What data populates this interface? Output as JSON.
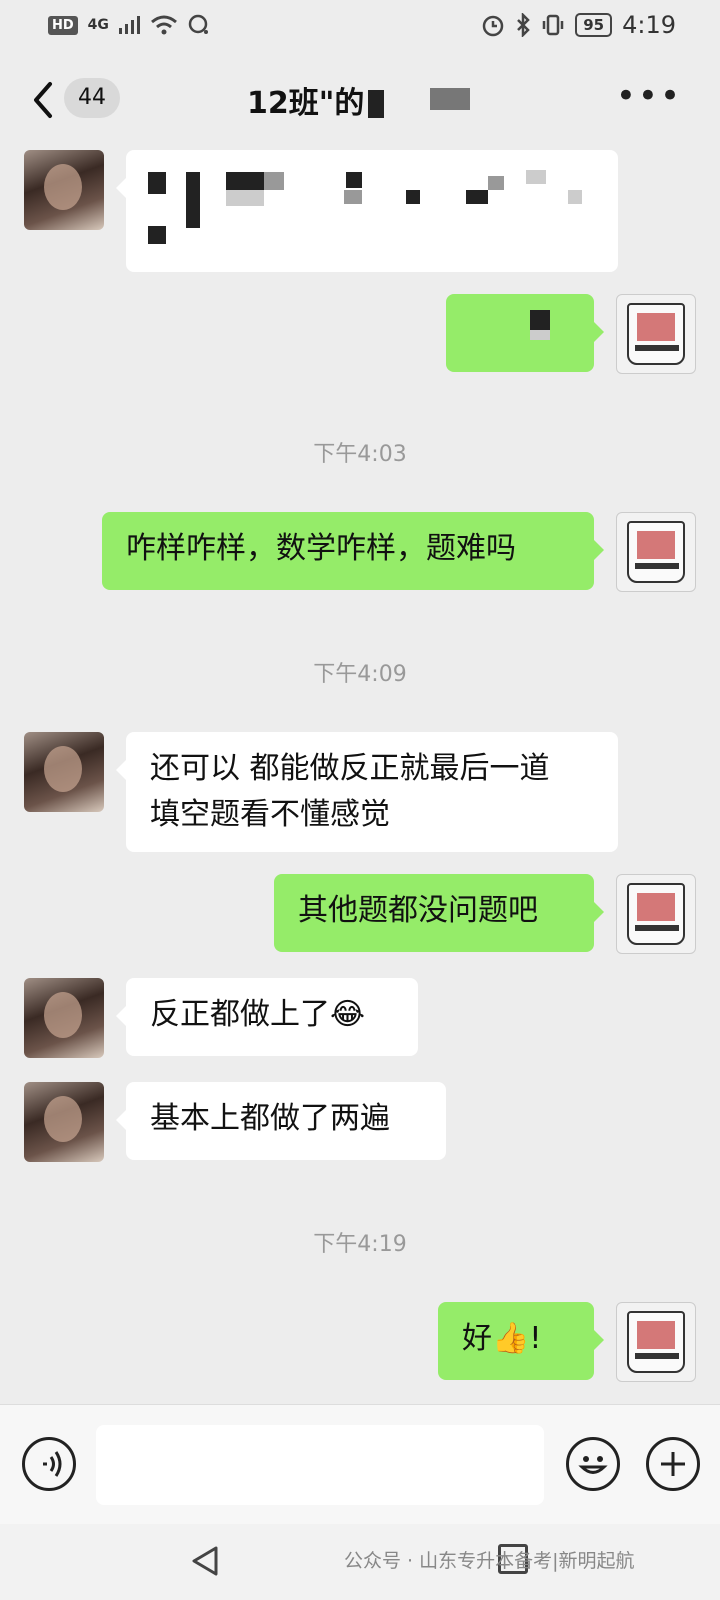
{
  "status_bar": {
    "hd": "HD",
    "network": "4G",
    "battery": "95",
    "time": "4:19"
  },
  "header": {
    "unread_count": "44",
    "title": "12班\"的"
  },
  "messages": [
    {
      "side": "left",
      "text": ""
    },
    {
      "side": "right",
      "text": ""
    },
    {
      "side": "right",
      "text": "咋样咋样，数学咋样，题难吗"
    },
    {
      "side": "left",
      "text": "还可以 都能做反正就最后一道\n填空题看不懂感觉"
    },
    {
      "side": "right",
      "text": "其他题都没问题吧"
    },
    {
      "side": "left",
      "text": "反正都做上了"
    },
    {
      "side": "left",
      "text": "基本上都做了两遍"
    },
    {
      "side": "right",
      "text": "好"
    }
  ],
  "emojis": {
    "laugh": "😂",
    "thumbs_up": "👍",
    "exclaim": "!"
  },
  "timestamps": [
    "下午4:03",
    "下午4:09",
    "下午4:19"
  ],
  "input": {
    "placeholder": "",
    "value": ""
  },
  "watermark": "公众号 · 山东专升本备考|新明起航",
  "icons": {
    "voice": "voice-icon",
    "emoji": "smiley-icon",
    "plus": "plus-icon",
    "more": "more-icon",
    "back": "back-icon"
  },
  "colors": {
    "background": "#ededed",
    "bubble_sent": "#95ec69",
    "bubble_received": "#ffffff",
    "timestamp": "#999999"
  }
}
